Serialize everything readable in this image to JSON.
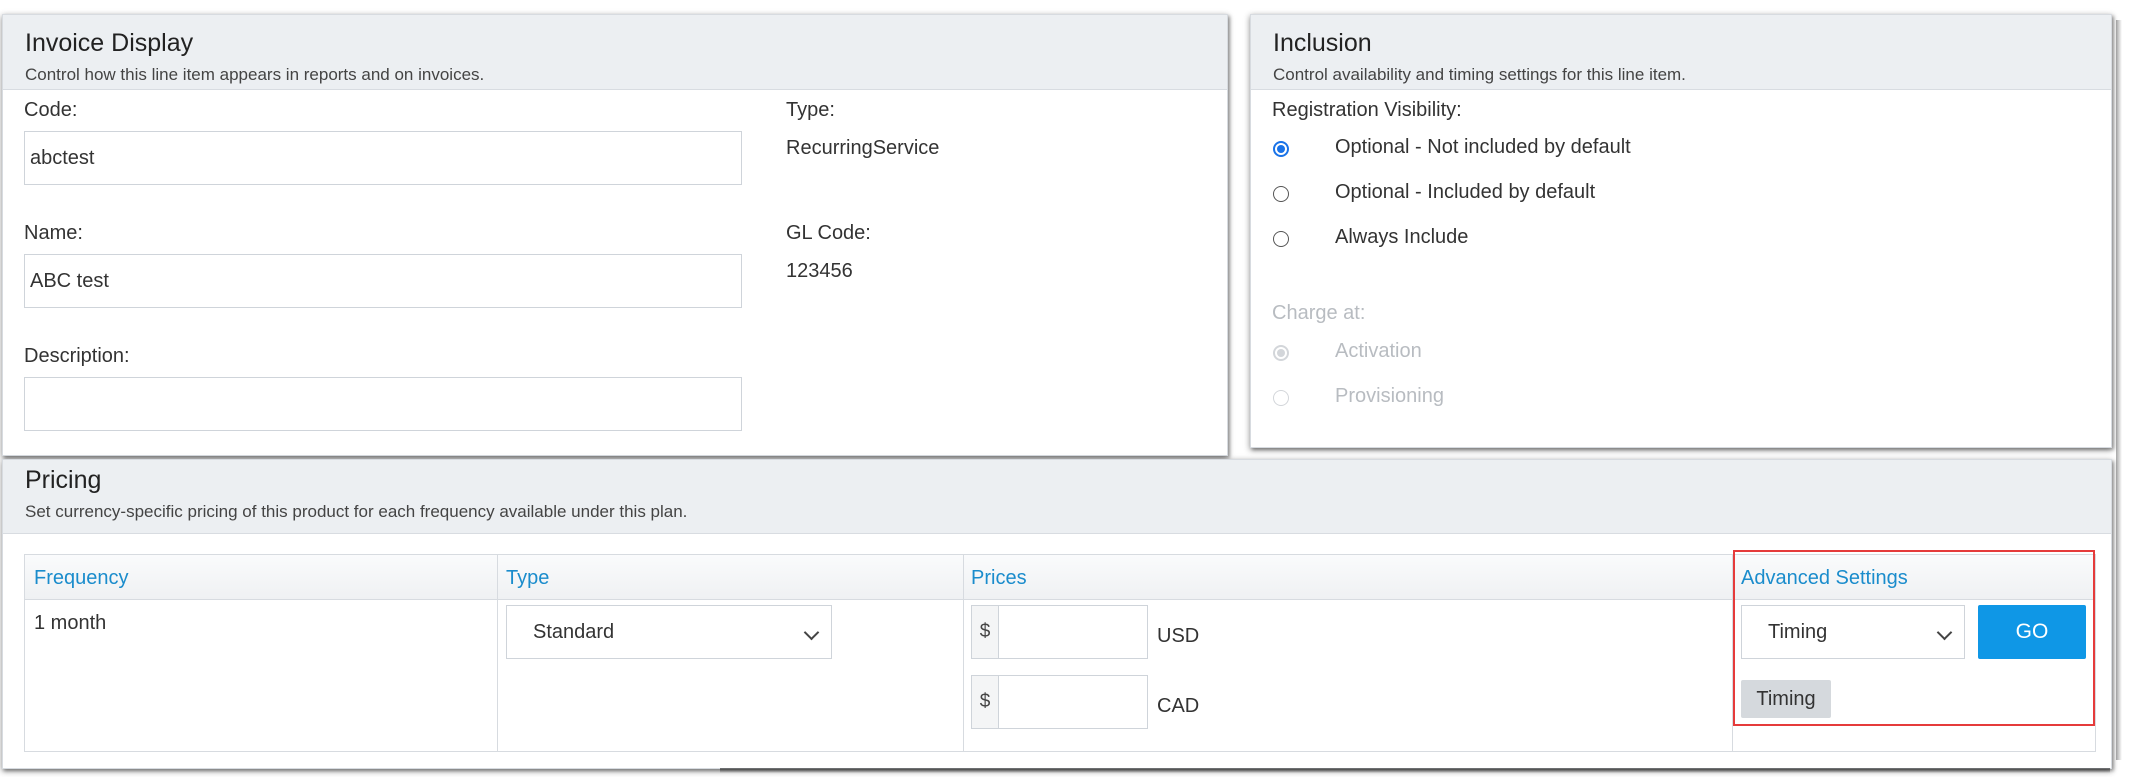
{
  "invoice_display": {
    "title": "Invoice Display",
    "subtitle": "Control how this line item appears in reports and on invoices.",
    "code_label": "Code:",
    "code_value": "abctest",
    "name_label": "Name:",
    "name_value": "ABC test",
    "description_label": "Description:",
    "description_value": "",
    "type_label": "Type:",
    "type_value": "RecurringService",
    "gl_code_label": "GL Code:",
    "gl_code_value": "123456"
  },
  "inclusion": {
    "title": "Inclusion",
    "subtitle": "Control availability and timing settings for this line item.",
    "visibility_label": "Registration Visibility:",
    "visibility_options": [
      {
        "label": "Optional - Not included by default",
        "checked": true
      },
      {
        "label": "Optional - Included by default",
        "checked": false
      },
      {
        "label": "Always Include",
        "checked": false
      }
    ],
    "charge_label": "Charge at:",
    "charge_options": [
      {
        "label": "Activation",
        "checked": true,
        "disabled": true
      },
      {
        "label": "Provisioning",
        "checked": false,
        "disabled": true
      }
    ]
  },
  "pricing": {
    "title": "Pricing",
    "subtitle": "Set currency-specific pricing of this product for each frequency available under this plan.",
    "columns": [
      "Frequency",
      "Type",
      "Prices",
      "Advanced Settings"
    ],
    "rows": [
      {
        "frequency": "1 month",
        "type": "Standard",
        "prices": [
          {
            "symbol": "$",
            "value": "",
            "currency": "USD"
          },
          {
            "symbol": "$",
            "value": "",
            "currency": "CAD"
          }
        ],
        "advanced_setting": "Timing",
        "go_label": "GO",
        "tag": "Timing"
      }
    ]
  },
  "colors": {
    "accent": "#0f97e6",
    "header_link": "#1a8ccc",
    "highlight": "#e53b3b",
    "radio_checked": "#1a73e8"
  }
}
